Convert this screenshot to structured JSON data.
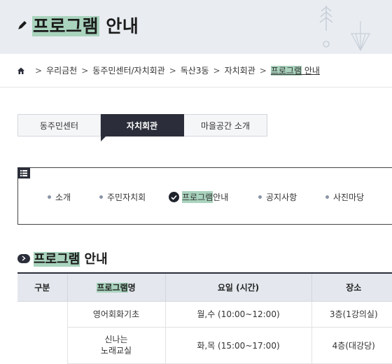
{
  "header": {
    "title_highlight": "프로그램",
    "title_rest": " 안내"
  },
  "breadcrumb": {
    "items": [
      "우리금천",
      "동주민센터/자치회관",
      "독산3동",
      "자치회관"
    ],
    "current_highlight": "프로그램",
    "current_rest": " 안내",
    "separator": ">"
  },
  "tabs": [
    {
      "label": "동주민센터",
      "active": false
    },
    {
      "label": "자치회관",
      "active": true
    },
    {
      "label": "마을공간 소개",
      "active": false
    }
  ],
  "subnav": {
    "items": [
      {
        "label": "소개"
      },
      {
        "label": "주민자치회"
      },
      {
        "label_highlight": "프로그램",
        "label_rest": " 안내",
        "selected": true
      },
      {
        "label": "공지사항"
      },
      {
        "label": "사진마당"
      }
    ]
  },
  "section": {
    "title_highlight": "프로그램",
    "title_rest": " 안내"
  },
  "table": {
    "headers": {
      "col1": "구분",
      "col2_highlight": "프로그램",
      "col2_rest": "명",
      "col3": "요일 (시간)",
      "col4": "장소"
    },
    "rows": [
      {
        "name": "영어회화기초",
        "schedule": "월,수 (10:00~12:00)",
        "place": "3층(1강의실)"
      },
      {
        "name_line1": "신나는",
        "name_line2": "노래교실",
        "schedule": "화,목 (15:00~17:00)",
        "place": "4층(대강당)"
      }
    ]
  },
  "colors": {
    "highlight": "#a9d3bd",
    "dark": "#2b2e3a",
    "header_bg": "#e9edf2"
  },
  "icons": [
    "pencil-icon",
    "home-icon",
    "menu-list-icon",
    "check-circle-icon",
    "chevron-right-icon"
  ]
}
